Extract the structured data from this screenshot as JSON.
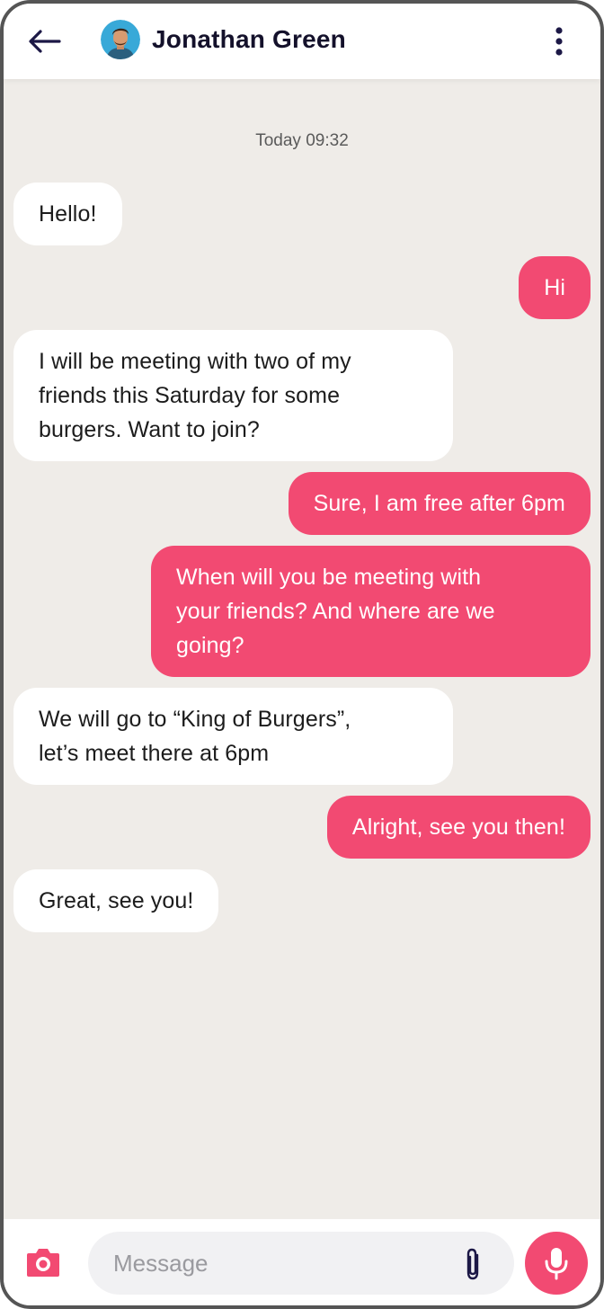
{
  "header": {
    "back_icon": "arrow-left-icon",
    "contact_name": "Jonathan Green",
    "menu_icon": "more-vertical-icon"
  },
  "chat": {
    "timestamp": "Today 09:32",
    "messages": [
      {
        "direction": "received",
        "text": "Hello!"
      },
      {
        "direction": "sent",
        "text": "Hi"
      },
      {
        "direction": "received",
        "text": "I will be meeting with two of my\nfriends this Saturday for some\nburgers. Want to join?"
      },
      {
        "direction": "sent",
        "text": "Sure, I am free after 6pm"
      },
      {
        "direction": "sent",
        "text": "When will you be meeting with\nyour friends? And where are we\ngoing?"
      },
      {
        "direction": "received",
        "text": "We will go to “King of Burgers”,\nlet’s meet there at 6pm"
      },
      {
        "direction": "sent",
        "text": "Alright, see you then!"
      },
      {
        "direction": "received",
        "text": "Great, see you!"
      }
    ]
  },
  "composer": {
    "placeholder": "Message",
    "value": "",
    "camera_icon": "camera-icon",
    "attach_icon": "paperclip-icon",
    "mic_icon": "microphone-icon"
  },
  "colors": {
    "accent": "#f24a72",
    "chat_background": "#efece8",
    "received_bubble": "#ffffff",
    "header_text": "#14112b"
  }
}
